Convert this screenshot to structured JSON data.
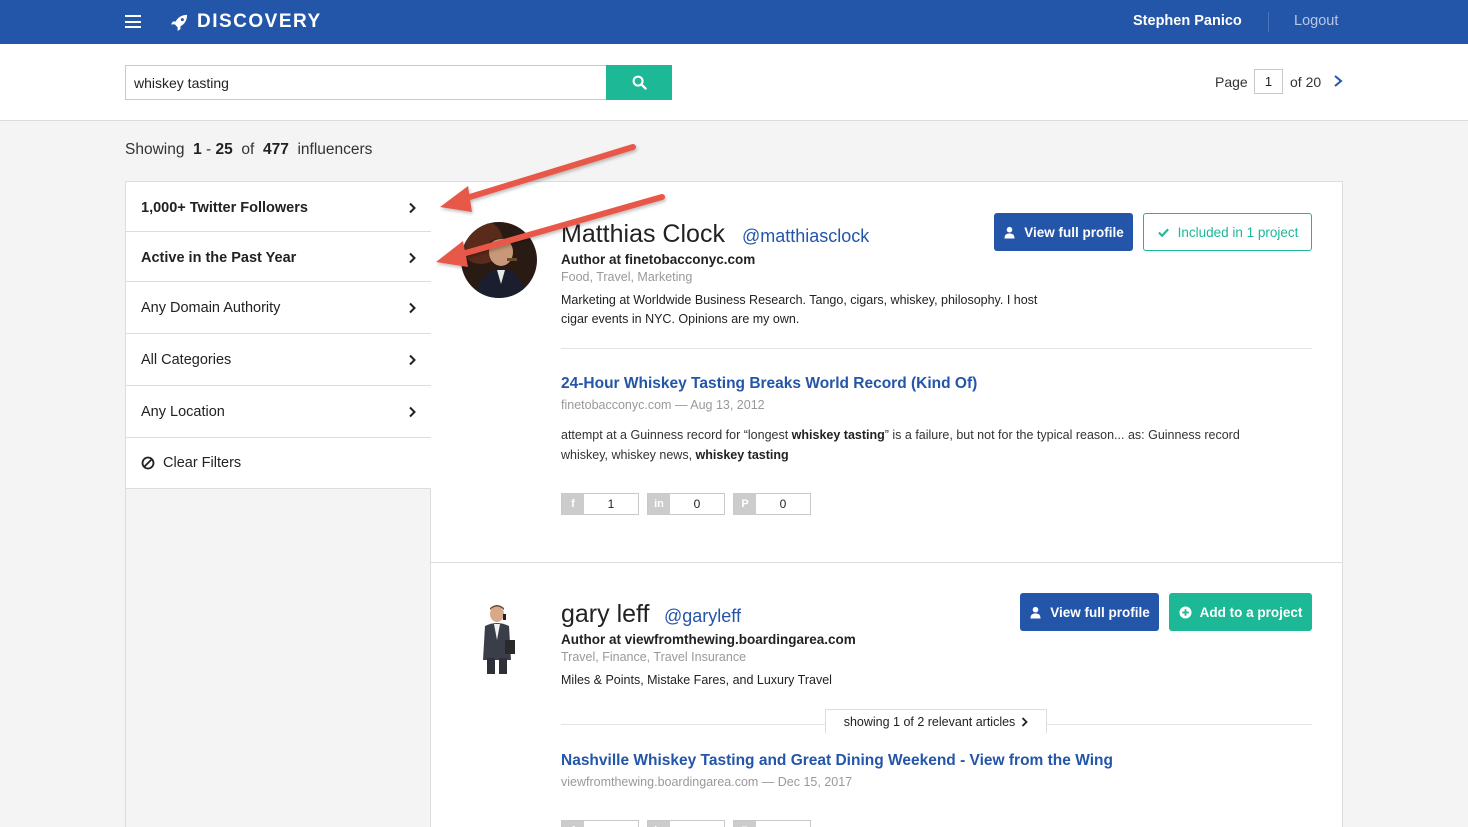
{
  "header": {
    "app_title": "DISCOVERY",
    "user_name": "Stephen Panico",
    "logout_label": "Logout"
  },
  "search": {
    "query": "whiskey tasting",
    "placeholder": ""
  },
  "pagination": {
    "page_label": "Page",
    "current_page": "1",
    "total_label": "of 20"
  },
  "results": {
    "prefix": "Showing",
    "range_start": "1",
    "range_sep": "-",
    "range_end": "25",
    "of_label": "of",
    "total": "477",
    "suffix": "influencers"
  },
  "filters": [
    {
      "label": "1,000+ Twitter Followers"
    },
    {
      "label": "Active in the Past Year"
    },
    {
      "label": "Any Domain Authority"
    },
    {
      "label": "All Categories"
    },
    {
      "label": "Any Location"
    }
  ],
  "clear_filters_label": "Clear Filters",
  "influencers": [
    {
      "name": "Matthias Clock",
      "handle": "@matthiasclock",
      "author": "Author at finetobacconyc.com",
      "categories": "Food, Travel, Marketing",
      "bio": "Marketing at Worldwide Business Research. Tango, cigars, whiskey, philosophy. I host cigar events in NYC. Opinions are my own.",
      "view_profile_label": "View full profile",
      "project_label": "Included in 1 project",
      "article": {
        "title": "24-Hour Whiskey Tasting Breaks World Record (Kind Of)",
        "meta": "finetobacconyc.com — Aug 13, 2012",
        "snippet_1": "attempt at a Guinness record for “longest ",
        "snippet_bold_1": "whiskey tasting",
        "snippet_2": "” is a failure, but not for the typical reason... as: Guinness record whiskey, whiskey news, ",
        "snippet_bold_2": "whiskey tasting"
      },
      "social": {
        "facebook": "1",
        "linkedin": "0",
        "pinterest": "0"
      }
    },
    {
      "name": "gary leff",
      "handle": "@garyleff",
      "author": "Author at viewfromthewing.boardingarea.com",
      "categories": "Travel, Finance, Travel Insurance",
      "bio": "Miles & Points, Mistake Fares, and Luxury Travel",
      "view_profile_label": "View full profile",
      "project_label": "Add to a project",
      "relevant_articles": "showing 1 of 2 relevant articles",
      "article": {
        "title": "Nashville Whiskey Tasting and Great Dining Weekend - View from the Wing",
        "meta": "viewfromthewing.boardingarea.com — Dec 15, 2017"
      }
    }
  ],
  "colors": {
    "brand_blue": "#2355a8",
    "accent_green": "#1db896",
    "annotation_red": "#e8584a"
  },
  "icons": {
    "menu": "hamburger-icon",
    "brand": "rocket-icon",
    "search": "search-icon",
    "next": "chevron-right-icon",
    "user": "user-icon",
    "check": "check-icon",
    "plus": "plus-circle-icon",
    "clear": "ban-icon"
  }
}
